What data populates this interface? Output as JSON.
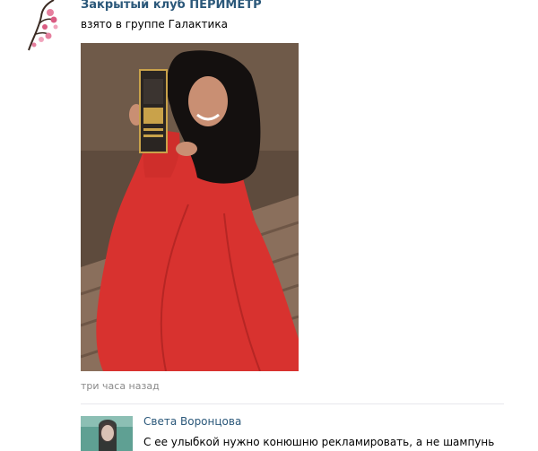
{
  "post": {
    "group_name": "Закрытый клуб ПЕРИМЕТР",
    "text": "взято в группе Галактика",
    "timestamp": "три часа назад",
    "photo_alt": "фото"
  },
  "comment": {
    "author": "Света Воронцова",
    "text": "С ее улыбкой нужно конюшню рекламировать, а не шампунь"
  },
  "colors": {
    "link": "#2b587a",
    "dress": "#d8322f",
    "muted": "#8a8a8a"
  }
}
